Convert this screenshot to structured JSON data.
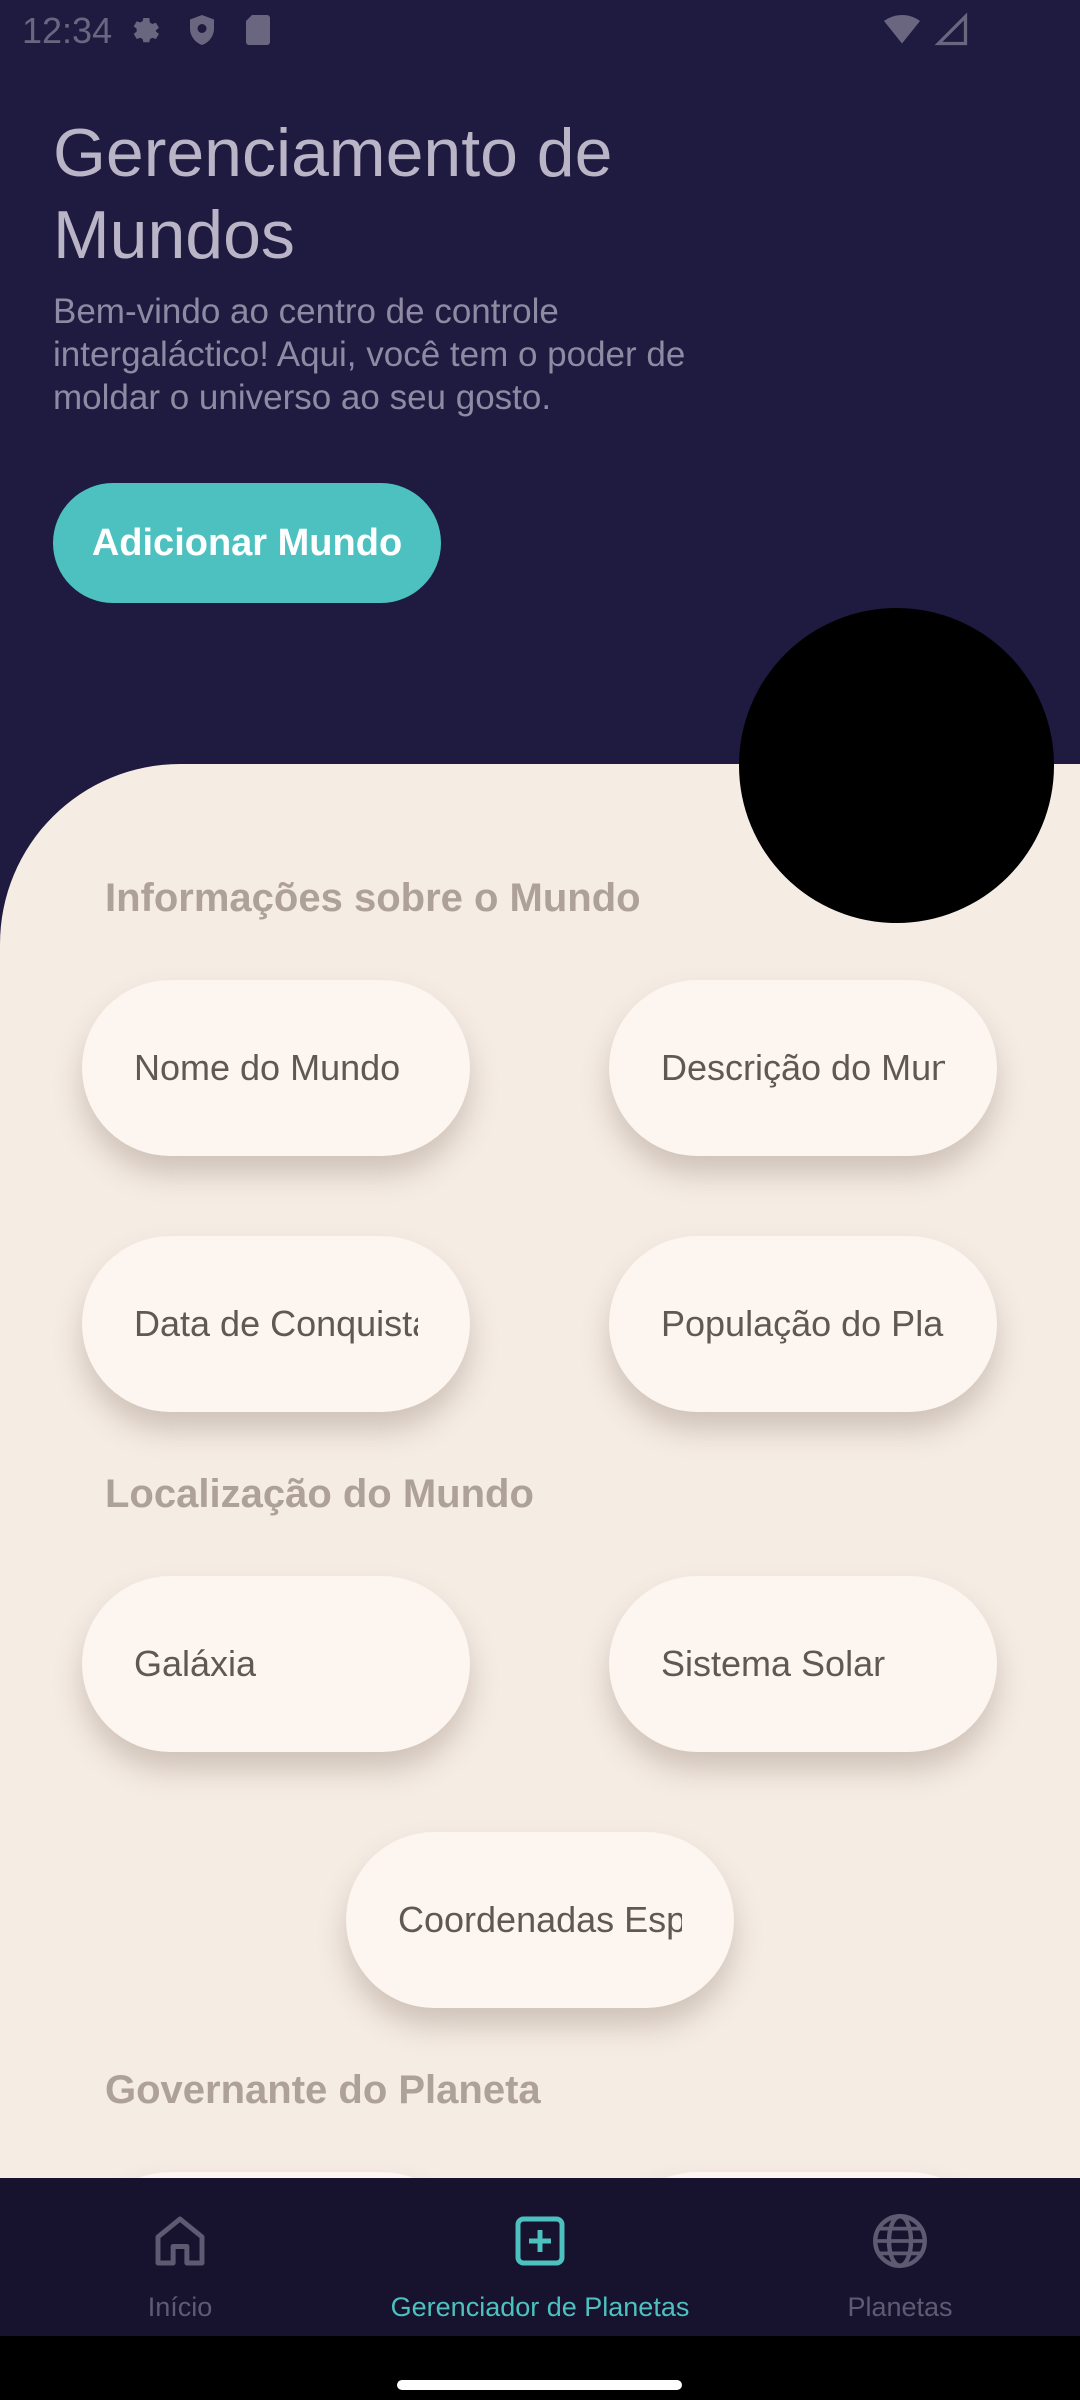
{
  "status": {
    "time": "12:34",
    "left_icons": [
      "gear-icon",
      "shield-icon",
      "sd-card-icon"
    ],
    "right_icons": [
      "wifi-icon",
      "signal-icon"
    ]
  },
  "header": {
    "title": "Gerenciamento de Mundos",
    "subtitle": "Bem-vindo ao centro de controle intergaláctico! Aqui, você tem o poder de moldar o universo ao seu gosto.",
    "add_button": "Adicionar Mundo"
  },
  "sections": {
    "info": "Informações sobre o Mundo",
    "location": "Localização do Mundo",
    "governor": "Governante do Planeta"
  },
  "fields": {
    "world_name": "Nome do Mundo",
    "world_description": "Descrição do Mundo",
    "conquest_date": "Data de Conquista",
    "population": "População do Planeta",
    "galaxy": "Galáxia",
    "solar_system": "Sistema Solar",
    "coordinates": "Coordenadas Espaciais"
  },
  "nav": {
    "home": "Início",
    "manager": "Gerenciador de Planetas",
    "planets": "Planetas",
    "active": "manager"
  },
  "colors": {
    "header_bg": "#1f1a3f",
    "accent": "#4cc1bf",
    "panel_bg": "#f5ece4",
    "field_bg": "#fcf5f0",
    "nav_bg": "#17132e"
  }
}
